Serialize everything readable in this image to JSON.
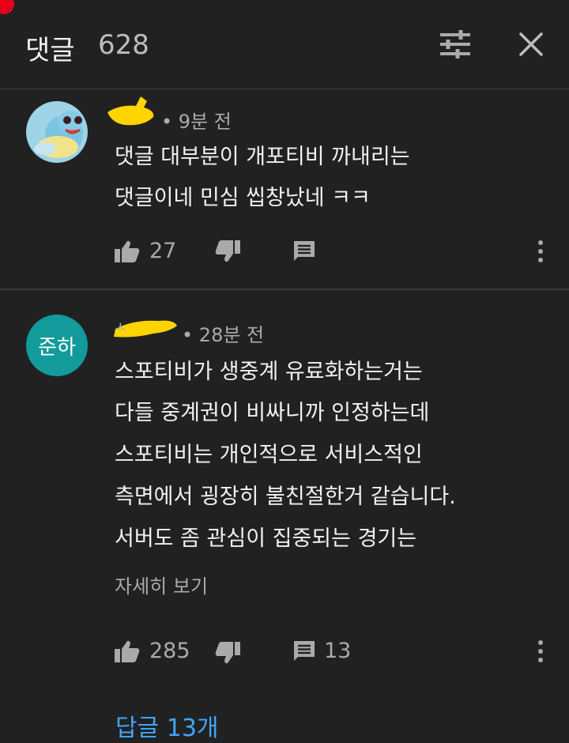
{
  "header": {
    "title": "댓글",
    "count": "628",
    "icons": {
      "filter": "sort-filter-icon",
      "close": "close-icon"
    }
  },
  "comments": [
    {
      "time": "9분 전",
      "lines": [
        "댓글 대부분이 개포티비 까내리는",
        "댓글이네 민심 씹창났네 ㅋㅋ"
      ],
      "likes": "27",
      "reply_count": ""
    },
    {
      "avatar_text": "준하",
      "time": "28분 전",
      "lines": [
        "스포티비가 생중계 유료화하는거는",
        "다들 중계권이 비싸니까 인정하는데",
        "스포티비는 개인적으로 서비스적인",
        "측면에서 굉장히 불친절한거 같습니다.",
        "서버도 좀 관심이 집중되는 경기는"
      ],
      "more": "자세히 보기",
      "likes": "285",
      "reply_count": "13",
      "replies_link": "답글 13개"
    }
  ],
  "colors": {
    "background": "#212121",
    "link": "#3ea6ff",
    "avatar": "#139a9b",
    "redaction": "#ffd400"
  }
}
